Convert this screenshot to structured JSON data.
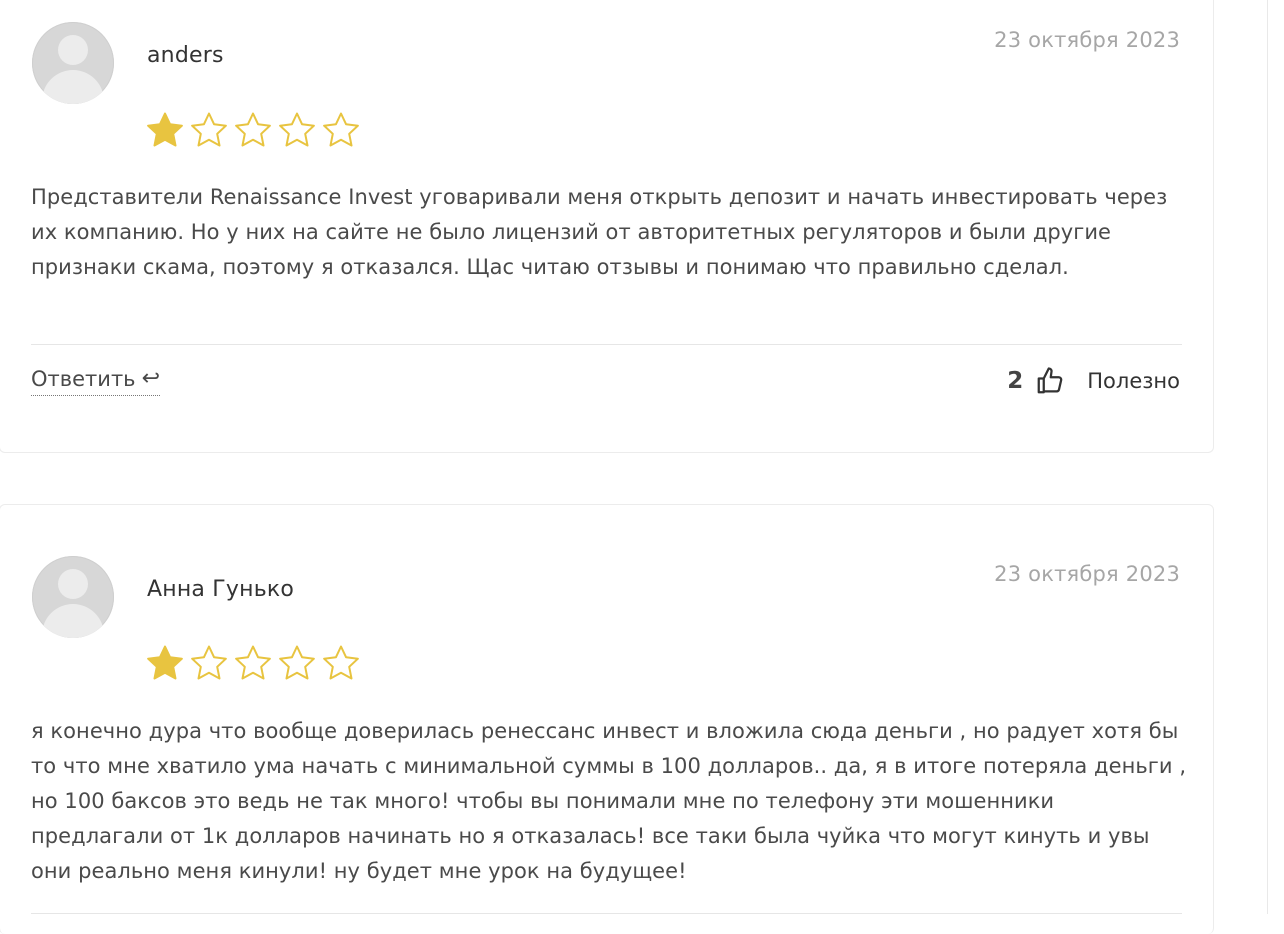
{
  "reviews": [
    {
      "author": "anders",
      "date": "23 октября 2023",
      "rating": 1,
      "rating_max": 5,
      "text": "Представители Renaissance Invest уговаривали меня открыть депозит и начать инвестировать через их компанию. Но у них на сайте не было лицензий от авторитетных регуляторов и были другие признаки скама, поэтому я отказался. Щас читаю отзывы и понимаю что правильно сделал.",
      "reply_label": "Ответить",
      "reply_icon": "↩",
      "helpful_count": "2",
      "helpful_label": "Полезно"
    },
    {
      "author": "Анна Гунько",
      "date": "23 октября 2023",
      "rating": 1,
      "rating_max": 5,
      "text": "я конечно дура что вообще доверилась ренессанс инвест и вложила сюда деньги , но радует хотя бы то что мне хватило ума начать с минимальной суммы в 100 долларов.. да, я в итоге потеряла деньги , но 100 баксов это ведь не так много! чтобы вы понимали мне по телефону эти мошенники предлагали от 1к долларов начинать но я отказалась! все таки была чуйка что могут кинуть и увы они реально меня кинули! ну будет мне урок на будущее!"
    }
  ],
  "colors": {
    "star": "#e8c440",
    "date": "#a6a6a6",
    "text": "#4a4a4a"
  },
  "icons": {
    "star": "star-icon",
    "thumb": "thumbs-up-icon",
    "reply": "reply-arrow-icon",
    "avatar": "user-avatar-placeholder"
  }
}
